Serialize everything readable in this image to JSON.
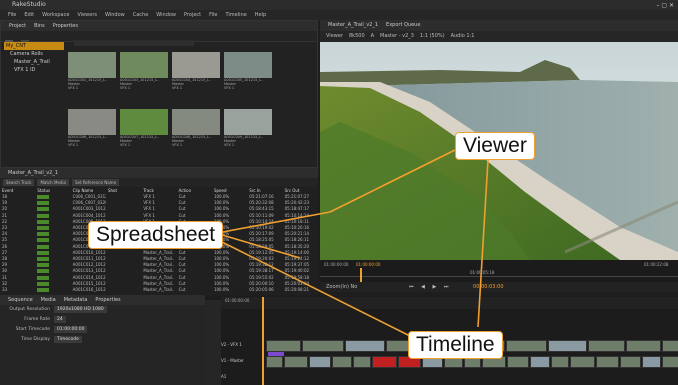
{
  "app": {
    "title": "RakeStudio",
    "menu": [
      "File",
      "Edit",
      "Workspace",
      "Viewers",
      "Window",
      "Cache",
      "Window",
      "Project",
      "File",
      "Timeline",
      "Help"
    ]
  },
  "browser": {
    "tabs": [
      "Project",
      "Bins",
      "Properties"
    ],
    "tree": [
      "My_CNT",
      "Camera Rolls",
      "Master_A_Trail",
      "VFX 1 ID"
    ],
    "thumbnails": [
      {
        "name": "A001C002_101215_L.. ",
        "scene": "Master",
        "take": "VFX 1",
        "color": "#7d8f76"
      },
      {
        "name": "A001C003_101215_L.. ",
        "scene": "Master",
        "take": "VFX 1",
        "color": "#6f8a5c"
      },
      {
        "name": "A001C004_101215_L.. ",
        "scene": "Master",
        "take": "VFX 1",
        "color": "#9a9a92"
      },
      {
        "name": "A001C005_101215_L.. ",
        "scene": "Master",
        "take": "VFX 1",
        "color": "#7e8c88"
      },
      {
        "name": "A001C006_101215_L.. ",
        "scene": "Master",
        "take": "VFX 1",
        "color": "#8a8a84"
      },
      {
        "name": "A001C007_101215_L.. ",
        "scene": "Master",
        "take": "VFX 1",
        "color": "#5f8b3f"
      },
      {
        "name": "A001C008_101215_L.. ",
        "scene": "Master",
        "take": "VFX 1",
        "color": "#848a80"
      },
      {
        "name": "A001C009_101215_L.. ",
        "scene": "Master",
        "take": "VFX 1",
        "color": "#9aa29d"
      }
    ]
  },
  "viewer": {
    "tabs": [
      "Master_A_Trail_v2_1",
      "Export Queue"
    ],
    "toolbar": [
      "Viewer",
      "8k500",
      "A",
      "Master - v2_3",
      "1:1 (50%)",
      "Audio 1:1"
    ],
    "timecodes": [
      "01:00:00:00",
      "01:00:00:00",
      "01:00:05:18",
      "01:00:22:08"
    ],
    "controls": [
      "Zoom(In) No",
      "00:00:03:00"
    ]
  },
  "spreadsheet": {
    "tab": "Master_A_Trail_v2_1",
    "buttons": [
      "Search Track",
      "Match Media",
      "Set Reference Name"
    ],
    "columns": [
      "Event",
      "Status",
      "Clip Name",
      "Shot",
      "Track",
      "Action",
      "Speed",
      "Src In",
      "Src Out"
    ],
    "rows": [
      [
        "18",
        "",
        "C006_C001_0312..",
        "",
        "VFX 1",
        "Cut",
        "100.0%",
        "05:21:07:16",
        "05:21:07:27"
      ],
      [
        "19",
        "",
        "C006_C007_0320..",
        "",
        "VFX 1",
        "Cut",
        "100.0%",
        "05:20:32:08",
        "05:20:42:23"
      ],
      [
        "20",
        "",
        "A001C003_1012..",
        "",
        "VFX 1",
        "Cut",
        "100.0%",
        "05:18:43:15",
        "05:18:47:17"
      ],
      [
        "21",
        "",
        "A001C004_1012..",
        "",
        "VFX 1",
        "Cut",
        "100.0%",
        "05:10:11:09",
        "05:10:14:24"
      ],
      [
        "22",
        "",
        "A001C005_1012..",
        "",
        "VFX 1",
        "Cut",
        "100.0%",
        "05:10:14:24",
        "05:10:18:11"
      ],
      [
        "23",
        "",
        "A001C006_1012..",
        "",
        "VFX 1",
        "Cut",
        "100.0%",
        "05:10:19:02",
        "05:10:20:16"
      ],
      [
        "24",
        "",
        "A001C007_1012..",
        "",
        "VFX 1",
        "Cut",
        "100.0%",
        "05:20:17:09",
        "05:20:21:14"
      ],
      [
        "25",
        "",
        "A001C008_1012..",
        "",
        "Master_A_Trail..",
        "Cut",
        "100.0%",
        "05:18:25:05",
        "05:18:26:11"
      ],
      [
        "26",
        "",
        "A001C009_1012..",
        "",
        "Master_A_Trail..",
        "Cut",
        "100.0%",
        "05:18:29:05",
        "05:18:35:20"
      ],
      [
        "27",
        "",
        "A001C010_1012..",
        "",
        "Master_A_Trail..",
        "Cut",
        "100.0%",
        "05:19:12:05",
        "05:19:14:00"
      ],
      [
        "28",
        "",
        "A001C011_1012..",
        "",
        "Master_A_Trail..",
        "Cut",
        "100.0%",
        "05:19:20:03",
        "05:19:24:12"
      ],
      [
        "29",
        "",
        "A001C012_1012..",
        "",
        "Master_A_Trail..",
        "Cut",
        "100.0%",
        "05:19:32:12",
        "05:19:37:05"
      ],
      [
        "30",
        "",
        "A001C013_1012..",
        "",
        "Master_A_Trail..",
        "Cut",
        "100.0%",
        "05:19:38:17",
        "05:19:40:02"
      ],
      [
        "31",
        "",
        "A001C014_1012..",
        "",
        "Master_A_Trail..",
        "Cut",
        "100.0%",
        "05:19:55:02",
        "05:19:58:18"
      ],
      [
        "32",
        "",
        "A001C015_1012..",
        "",
        "Master_A_Trail..",
        "Cut",
        "100.0%",
        "05:20:00:10",
        "05:20:03:04"
      ],
      [
        "33",
        "",
        "A001C016_1012..",
        "",
        "Master_A_Trail..",
        "Cut",
        "100.0%",
        "05:20:05:06",
        "05:20:08:21"
      ]
    ]
  },
  "properties": {
    "tabs": [
      "Sequence",
      "Media",
      "Metadata",
      "Properties"
    ],
    "fields": [
      {
        "label": "Output Resolution",
        "value": "1920x1080 HD 1080"
      },
      {
        "label": "Frame Rate",
        "value": "24"
      },
      {
        "label": "Start Timecode",
        "value": "01:00:00:00"
      },
      {
        "label": "Time Display",
        "value": "Timecode"
      }
    ]
  },
  "timeline": {
    "timecode": "01:00:00:00",
    "tracks": [
      "V2 - VFX 1",
      "V1 - Master",
      "A1"
    ],
    "clips_v2": 11,
    "clips_v1": 22
  },
  "callouts": {
    "viewer": "Viewer",
    "spreadsheet": "Spreadsheet",
    "timeline": "Timeline"
  },
  "colors": {
    "accent": "#f0a030",
    "status_ok": "#4a8a2a",
    "clip_audio": "#c02020"
  }
}
